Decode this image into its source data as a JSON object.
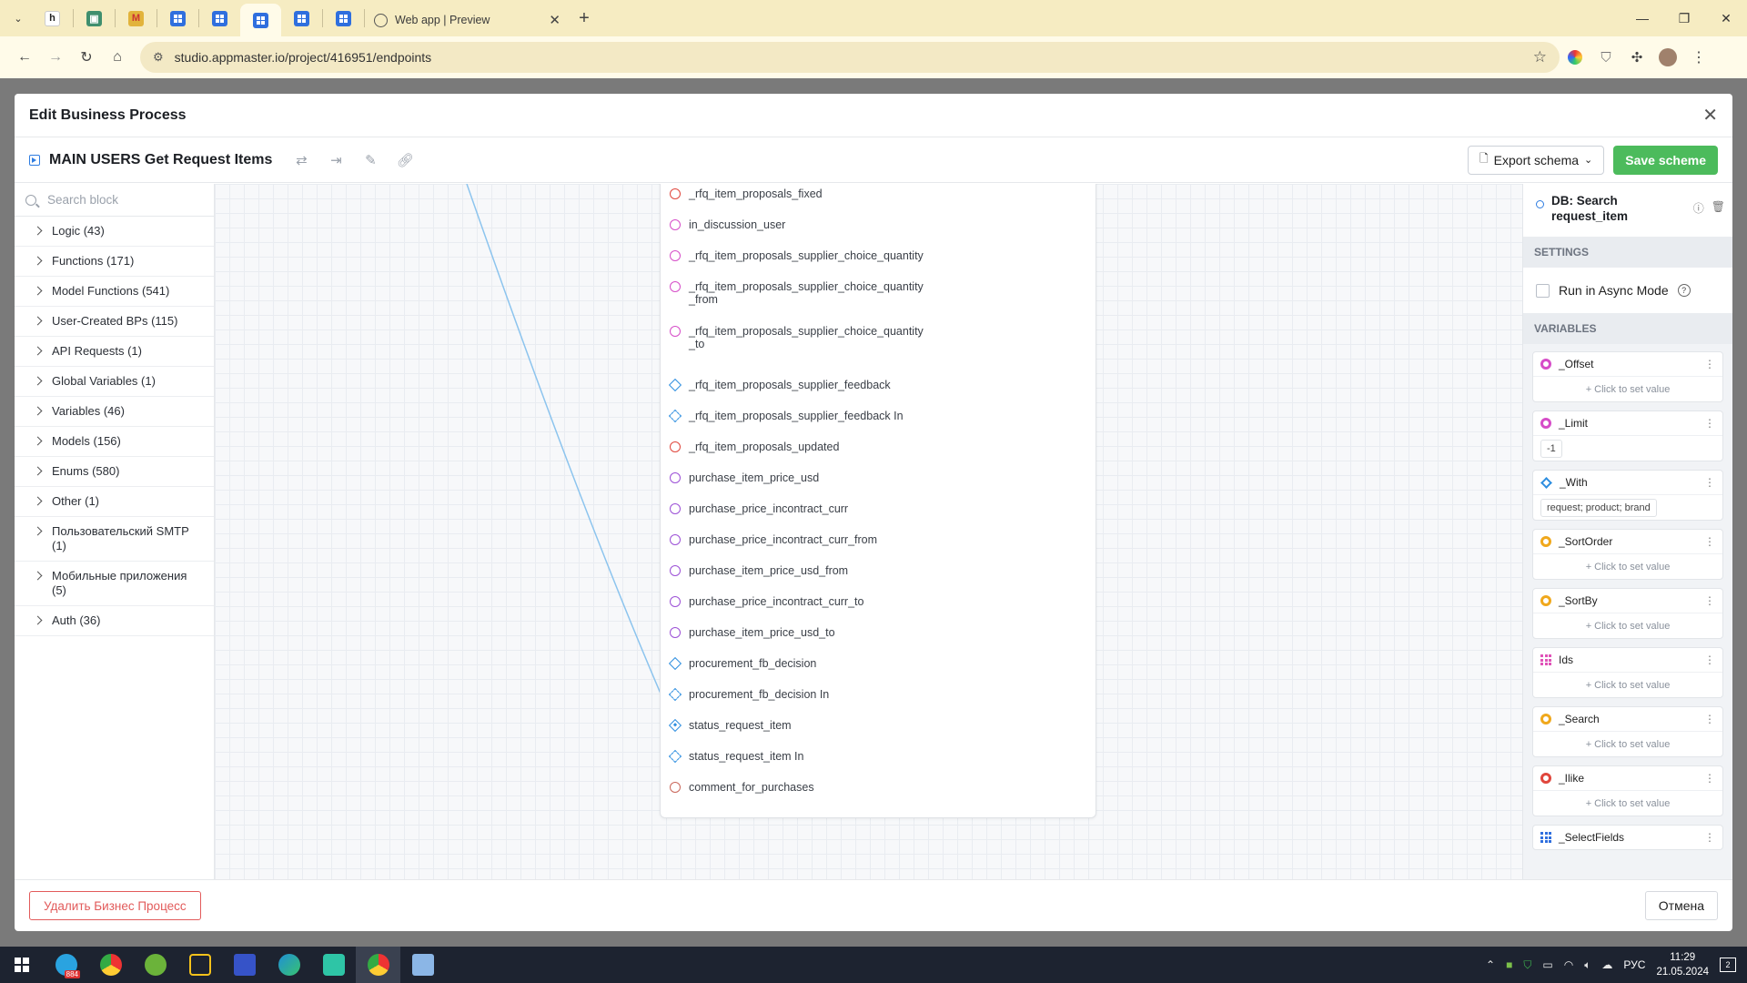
{
  "browser": {
    "active_tab_title": "Web app | Preview",
    "url": "studio.appmaster.io/project/416951/endpoints"
  },
  "modal": {
    "title": "Edit Business Process",
    "bp_name": "MAIN USERS Get Request Items",
    "export_label": "Export schema",
    "save_label": "Save scheme",
    "delete_label": "Удалить Бизнес Процесс",
    "cancel_label": "Отмена"
  },
  "sidebar": {
    "search_placeholder": "Search block",
    "categories": [
      "Logic (43)",
      "Functions (171)",
      "Model Functions (541)",
      "User-Created BPs (115)",
      "API Requests (1)",
      "Global Variables (1)",
      "Variables (46)",
      "Models (156)",
      "Enums (580)",
      "Other (1)",
      "Пользовательский SMTP (1)",
      "Мобильные приложения (5)",
      "Auth (36)"
    ]
  },
  "node": {
    "ports": [
      {
        "label": "_rfq_item_proposals_fixed",
        "kind": "circle",
        "color": "#e0463c"
      },
      {
        "label": "in_discussion_user",
        "kind": "circle",
        "color": "#d64dc8"
      },
      {
        "label": "_rfq_item_proposals_supplier_choice_quantity",
        "kind": "circle",
        "color": "#d64dc8"
      },
      {
        "label": "_rfq_item_proposals_supplier_choice_quantity\n_from",
        "kind": "circle",
        "color": "#d64dc8"
      },
      {
        "label": "_rfq_item_proposals_supplier_choice_quantity\n_to",
        "kind": "circle",
        "color": "#d64dc8"
      },
      {
        "label": "_rfq_item_proposals_supplier_feedback",
        "kind": "diamond"
      },
      {
        "label": "_rfq_item_proposals_supplier_feedback In",
        "kind": "diamond-dashed"
      },
      {
        "label": "_rfq_item_proposals_updated",
        "kind": "circle",
        "color": "#e0463c"
      },
      {
        "label": "purchase_item_price_usd",
        "kind": "circle",
        "color": "#9b4fd6"
      },
      {
        "label": "purchase_price_incontract_curr",
        "kind": "circle",
        "color": "#9b4fd6"
      },
      {
        "label": "purchase_price_incontract_curr_from",
        "kind": "circle",
        "color": "#9b4fd6"
      },
      {
        "label": "purchase_item_price_usd_from",
        "kind": "circle",
        "color": "#9b4fd6"
      },
      {
        "label": "purchase_price_incontract_curr_to",
        "kind": "circle",
        "color": "#9b4fd6"
      },
      {
        "label": "purchase_item_price_usd_to",
        "kind": "circle",
        "color": "#9b4fd6"
      },
      {
        "label": "procurement_fb_decision",
        "kind": "diamond"
      },
      {
        "label": "procurement_fb_decision In",
        "kind": "diamond-dashed"
      },
      {
        "label": "status_request_item",
        "kind": "diamond-filled"
      },
      {
        "label": "status_request_item In",
        "kind": "diamond-dashed"
      },
      {
        "label": "comment_for_purchases",
        "kind": "circle",
        "color": "#c9665a"
      }
    ]
  },
  "inspector": {
    "block_name": "DB: Search request_item",
    "settings_label": "SETTINGS",
    "async_label": "Run in Async Mode",
    "variables_label": "VARIABLES",
    "variables": [
      {
        "name": "_Offset",
        "icon": "dot",
        "color": "#d64dc8",
        "value": "+ Click to set value",
        "is_value": false
      },
      {
        "name": "_Limit",
        "icon": "dot",
        "color": "#d64dc8",
        "value": "-1",
        "is_value": true
      },
      {
        "name": "_With",
        "icon": "diamond",
        "color": "#2f8fe0",
        "value": "request; product; brand",
        "is_value": true
      },
      {
        "name": "_SortOrder",
        "icon": "dot",
        "color": "#f0a81c",
        "value": "+ Click to set value",
        "is_value": false
      },
      {
        "name": "_SortBy",
        "icon": "dot",
        "color": "#f0a81c",
        "value": "+ Click to set value",
        "is_value": false
      },
      {
        "name": "Ids",
        "icon": "grid",
        "color": "#e052b8",
        "value": "+ Click to set value",
        "is_value": false
      },
      {
        "name": "_Search",
        "icon": "dot",
        "color": "#f0a81c",
        "value": "+ Click to set value",
        "is_value": false
      },
      {
        "name": "_Ilike",
        "icon": "dot",
        "color": "#e0463c",
        "value": "+ Click to set value",
        "is_value": false
      },
      {
        "name": "_SelectFields",
        "icon": "grid",
        "color": "#2f6fde",
        "value": "",
        "is_value": false
      }
    ]
  },
  "taskbar": {
    "lang": "РУС",
    "time": "11:29",
    "date": "21.05.2024",
    "telegram_badge": "884",
    "notifications": "2"
  }
}
